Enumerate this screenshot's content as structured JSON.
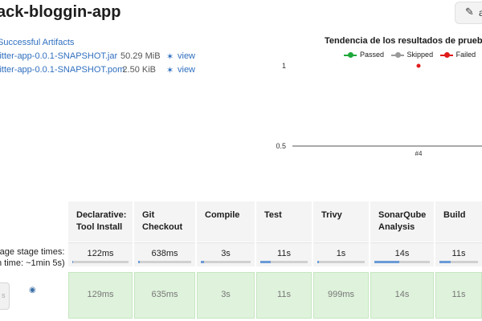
{
  "header": {
    "title": "ack-bloggin-app",
    "edit_label": "a"
  },
  "artifacts": {
    "heading": "Successful Artifacts",
    "items": [
      {
        "name": "litter-app-0.0.1-SNAPSHOT.jar",
        "size": "50.29 MiB",
        "action": "view"
      },
      {
        "name": "litter-app-0.0.1-SNAPSHOT.pom",
        "size": "2.50 KiB",
        "action": "view"
      }
    ]
  },
  "chart_data": {
    "type": "line",
    "title": "Tendencia de los resultados de prueb",
    "x": [
      "#4"
    ],
    "series": [
      {
        "name": "Passed",
        "color": "#1fa83a",
        "values": [
          null
        ]
      },
      {
        "name": "Skipped",
        "color": "#9a9a9a",
        "values": [
          null
        ]
      },
      {
        "name": "Failed",
        "color": "#e01b1b",
        "values": [
          1
        ]
      }
    ],
    "yticks": [
      "1",
      "0.5"
    ],
    "ylim": [
      0.5,
      1
    ],
    "legend": "top"
  },
  "stage_view": {
    "avg_label_1": "rage stage times:",
    "avg_label_2": "n time: ~1min 5s)",
    "stub_text": "s",
    "stages": [
      {
        "name_line1": "Declarative:",
        "name_line2": "Tool Install",
        "avg": "122ms",
        "avg_frac": 0.01,
        "run": "129ms"
      },
      {
        "name_line1": "Git",
        "name_line2": "Checkout",
        "avg": "638ms",
        "avg_frac": 0.03,
        "run": "635ms"
      },
      {
        "name_line1": "Compile",
        "name_line2": "",
        "avg": "3s",
        "avg_frac": 0.07,
        "run": "3s"
      },
      {
        "name_line1": "Test",
        "name_line2": "",
        "avg": "11s",
        "avg_frac": 0.22,
        "run": "11s"
      },
      {
        "name_line1": "Trivy",
        "name_line2": "",
        "avg": "1s",
        "avg_frac": 0.03,
        "run": "999ms"
      },
      {
        "name_line1": "SonarQube",
        "name_line2": "Analysis",
        "avg": "14s",
        "avg_frac": 0.45,
        "run": "14s"
      },
      {
        "name_line1": "Build",
        "name_line2": "",
        "avg": "11s",
        "avg_frac": 0.3,
        "run": "11s"
      }
    ]
  }
}
